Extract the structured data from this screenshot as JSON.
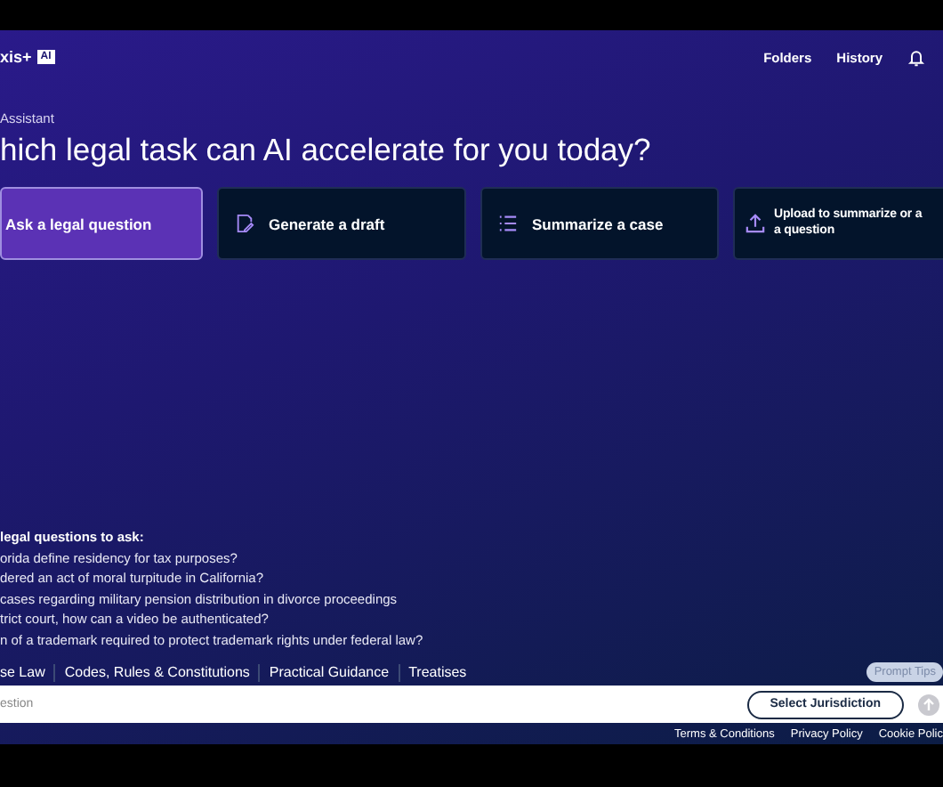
{
  "header": {
    "logo_text": "xis+",
    "logo_badge": "AI",
    "nav": [
      "Folders",
      "History"
    ]
  },
  "eyebrow": "Assistant",
  "heading": "hich legal task can AI accelerate for you today?",
  "tasks": [
    {
      "label": "Ask a legal question",
      "selected": true,
      "kind": "none"
    },
    {
      "label": "Generate a draft",
      "selected": false,
      "kind": "draft"
    },
    {
      "label": "Summarize a case",
      "selected": false,
      "kind": "list"
    },
    {
      "label": "Upload to summarize or a a question",
      "selected": false,
      "kind": "upload"
    }
  ],
  "examples": {
    "title": "legal questions to ask:",
    "items": [
      "orida define residency for tax purposes?",
      "dered an act of moral turpitude in California?",
      "cases regarding military pension distribution in divorce proceedings",
      "trict court, how can a video be authenticated?",
      "n of a trademark required to protect trademark rights under federal law?"
    ]
  },
  "sources": [
    "se Law",
    "Codes, Rules & Constitutions",
    "Practical Guidance",
    "Treatises"
  ],
  "prompt_tips": "Prompt Tips",
  "input": {
    "placeholder": "estion",
    "jurisdiction_button": "Select Jurisdiction"
  },
  "footer": [
    "Terms & Conditions",
    "Privacy Policy",
    "Cookie Polic"
  ]
}
